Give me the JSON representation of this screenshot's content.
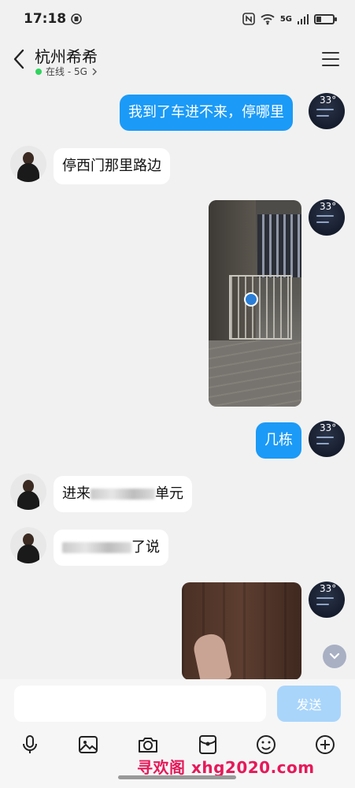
{
  "status_bar": {
    "time": "17:18",
    "network": "5G"
  },
  "header": {
    "title": "杭州希希",
    "presence": "在线 - 5G"
  },
  "my_avatar": {
    "weather_temp": "33°"
  },
  "messages": [
    {
      "from": "me",
      "type": "text",
      "text": "我到了车进不来，停哪里"
    },
    {
      "from": "other",
      "type": "text",
      "text": "停西门那里路边"
    },
    {
      "from": "me",
      "type": "image"
    },
    {
      "from": "me",
      "type": "text",
      "text": "几栋"
    },
    {
      "from": "other",
      "type": "text",
      "text_visible_start": "进来",
      "text_visible_end": "单元"
    },
    {
      "from": "other",
      "type": "text",
      "text_visible_end": "了说"
    },
    {
      "from": "me",
      "type": "image"
    }
  ],
  "composer": {
    "input_value": "",
    "send_label": "发送"
  },
  "toolbar": [
    "microphone-icon",
    "image-icon",
    "camera-icon",
    "red-packet-icon",
    "emoji-icon",
    "plus-icon"
  ],
  "watermark": "寻欢阁 xhg2020.com",
  "colors": {
    "my_bubble": "#1b9af7",
    "other_bubble": "#ffffff",
    "send_button": "#a9d5fb",
    "online_dot": "#2fd45e",
    "watermark": "#e6195a"
  }
}
